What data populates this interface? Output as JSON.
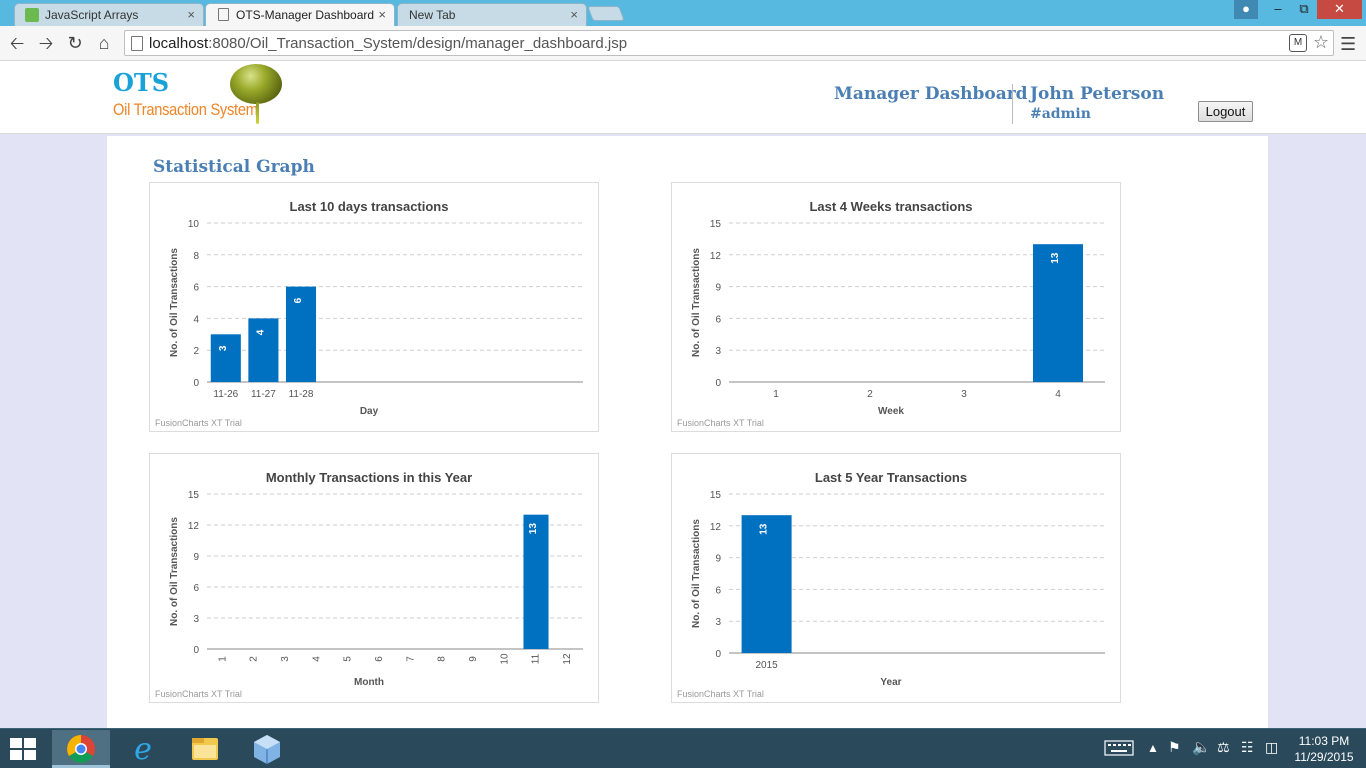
{
  "browser": {
    "tabs": [
      {
        "title": "JavaScript Arrays",
        "active": false
      },
      {
        "title": "OTS-Manager Dashboard",
        "active": true
      },
      {
        "title": "New Tab",
        "active": false
      }
    ],
    "close_glyph": "×",
    "url_host": "localhost",
    "url_path": ":8080/Oil_Transaction_System/design/manager_dashboard.jsp",
    "icons": [
      "back-arrow-icon",
      "forward-arrow-icon",
      "reload-icon",
      "home-icon",
      "bookmark-star-icon",
      "menu-icon"
    ]
  },
  "header": {
    "logo_title": "OTS",
    "logo_subtitle": "Oil Transaction System",
    "page_title": "Manager Dashboard",
    "user_name": "John Peterson",
    "user_role": "#admin",
    "logout_label": "Logout"
  },
  "content": {
    "section_title": "Statistical Graph"
  },
  "colors": {
    "bar": "#0070c0",
    "heading": "#4b7fb3",
    "logo_blue": "#19a2d8",
    "logo_orange": "#f08426"
  },
  "chart_data": [
    {
      "type": "bar",
      "title": "Last 10 days transactions",
      "xlabel": "Day",
      "ylabel": "No. of Oil Transactions",
      "categories": [
        "11-26",
        "11-27",
        "11-28"
      ],
      "values": [
        3,
        4,
        6
      ],
      "slots": 10,
      "ylim": [
        0,
        10
      ],
      "yticks": [
        0,
        2,
        4,
        6,
        8,
        10
      ],
      "footer": "FusionCharts XT Trial"
    },
    {
      "type": "bar",
      "title": "Last 4 Weeks transactions",
      "xlabel": "Week",
      "ylabel": "No. of Oil Transactions",
      "categories": [
        "1",
        "2",
        "3",
        "4"
      ],
      "values": [
        0,
        0,
        0,
        13
      ],
      "slots": 4,
      "ylim": [
        0,
        15
      ],
      "yticks": [
        0,
        3,
        6,
        9,
        12,
        15
      ],
      "footer": "FusionCharts XT Trial"
    },
    {
      "type": "bar",
      "title": "Monthly Transactions in this Year",
      "xlabel": "Month",
      "ylabel": "No. of Oil Transactions",
      "categories": [
        "1",
        "2",
        "3",
        "4",
        "5",
        "6",
        "7",
        "8",
        "9",
        "10",
        "11",
        "12"
      ],
      "values": [
        0,
        0,
        0,
        0,
        0,
        0,
        0,
        0,
        0,
        0,
        13,
        0
      ],
      "slots": 12,
      "rotate_xlabels": true,
      "ylim": [
        0,
        15
      ],
      "yticks": [
        0,
        3,
        6,
        9,
        12,
        15
      ],
      "footer": "FusionCharts XT Trial"
    },
    {
      "type": "bar",
      "title": "Last 5 Year Transactions",
      "xlabel": "Year",
      "ylabel": "No. of Oil Transactions",
      "categories": [
        "2015"
      ],
      "values": [
        13
      ],
      "slots": 5,
      "ylim": [
        0,
        15
      ],
      "yticks": [
        0,
        3,
        6,
        9,
        12,
        15
      ],
      "footer": "FusionCharts XT Trial"
    }
  ],
  "taskbar": {
    "apps": [
      "chrome-icon",
      "internet-explorer-icon",
      "file-explorer-icon",
      "virtualbox-icon"
    ],
    "time": "11:03 PM",
    "date": "11/29/2015"
  }
}
